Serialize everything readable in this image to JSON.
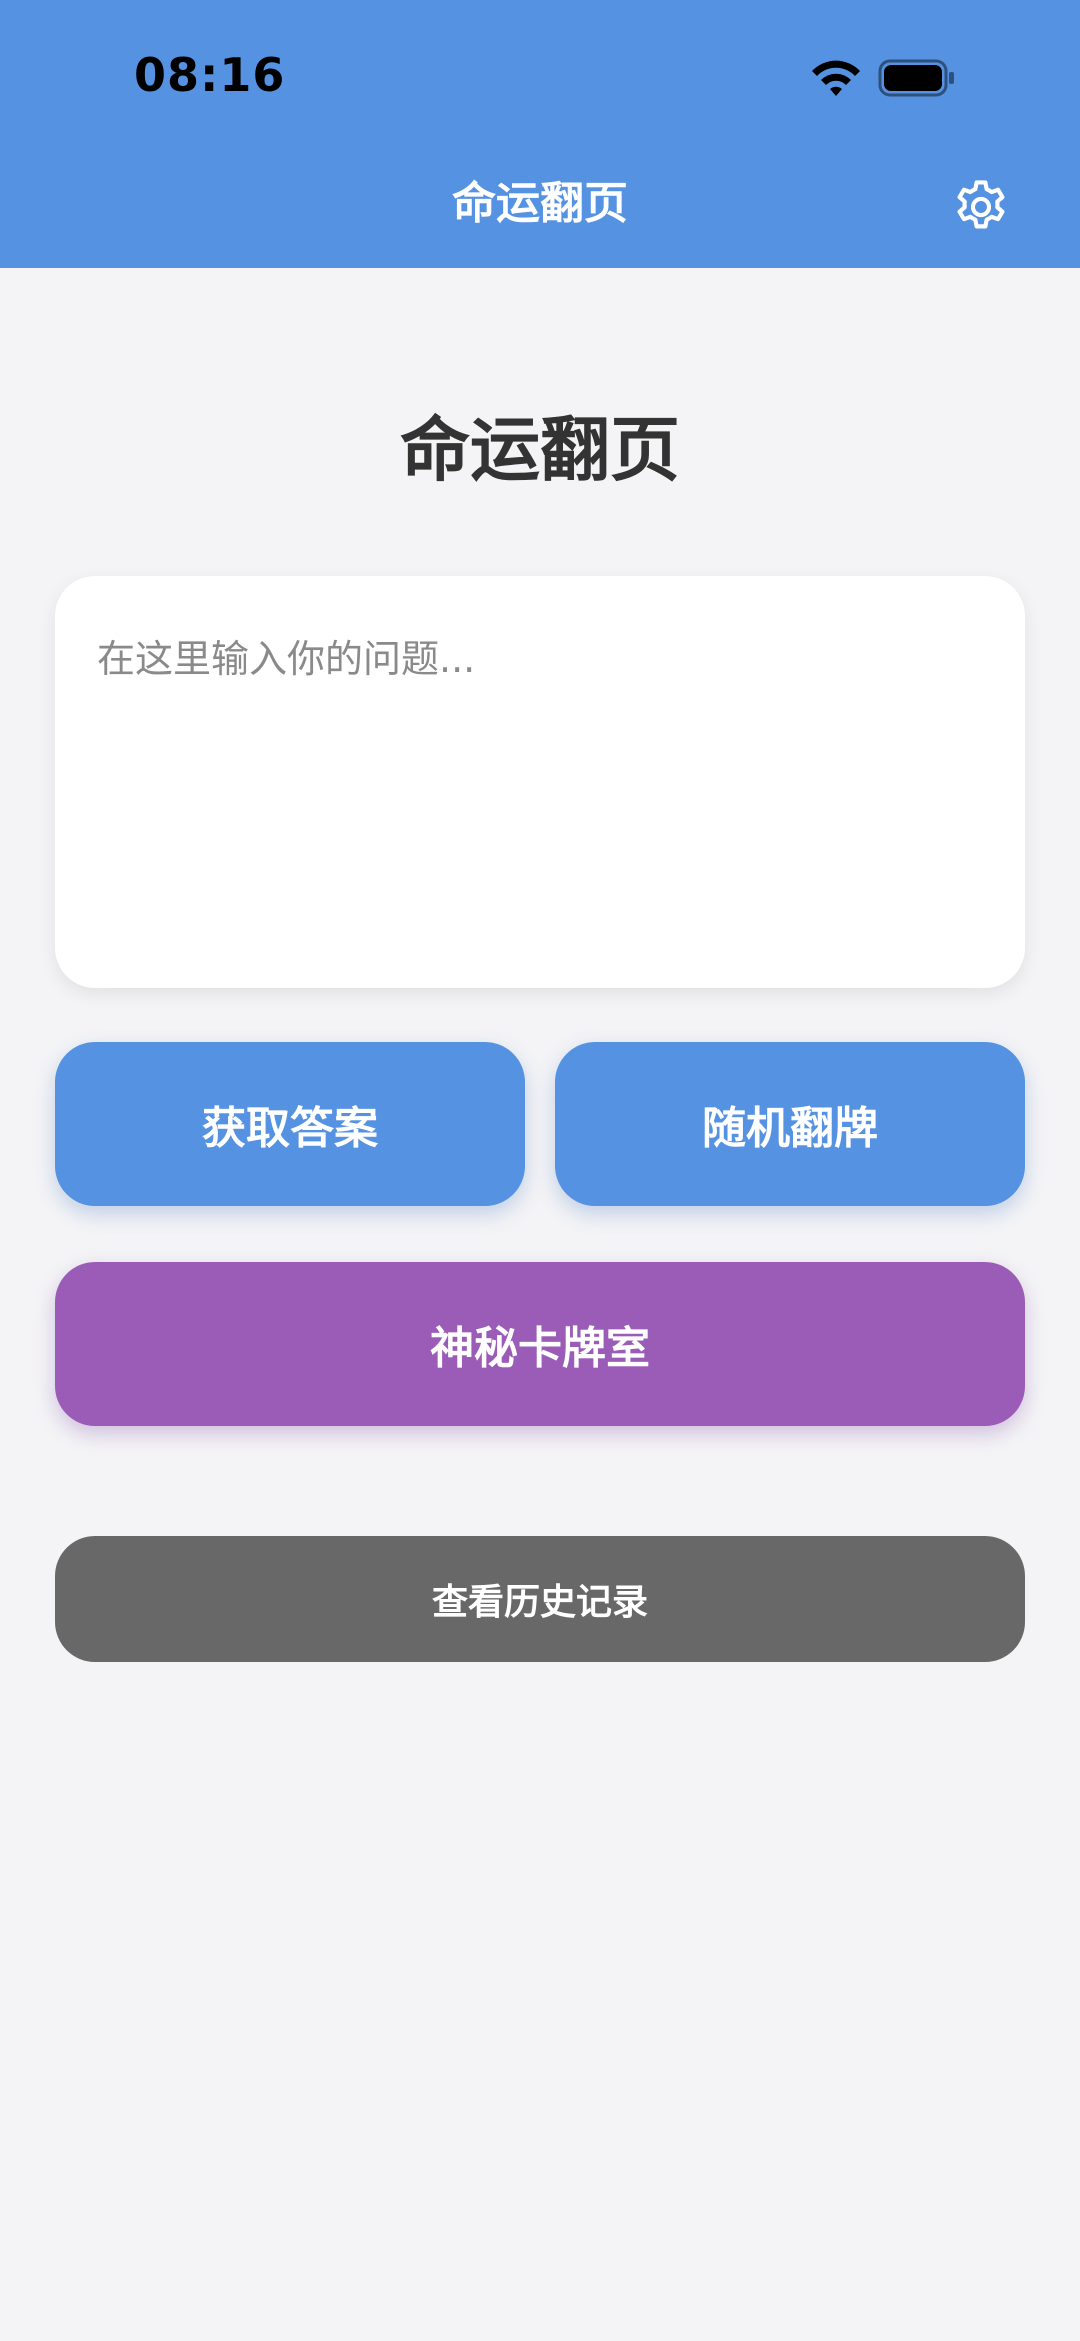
{
  "status_bar": {
    "time": "08:16",
    "icons": [
      "wifi-icon",
      "battery-icon"
    ]
  },
  "header": {
    "title": "命运翻页",
    "settings_icon": "gear-icon"
  },
  "main": {
    "title": "命运翻页",
    "question_input": {
      "placeholder": "在这里输入你的问题...",
      "value": ""
    },
    "buttons": {
      "get_answer": "获取答案",
      "random_flip": "随机翻牌",
      "mystery_room": "神秘卡牌室",
      "history": "查看历史记录"
    }
  },
  "colors": {
    "header_bg": "#5592e2",
    "primary_button": "#5592e2",
    "mystery_button": "#9b5cb8",
    "history_button": "#686868",
    "page_bg": "#f4f4f6"
  }
}
